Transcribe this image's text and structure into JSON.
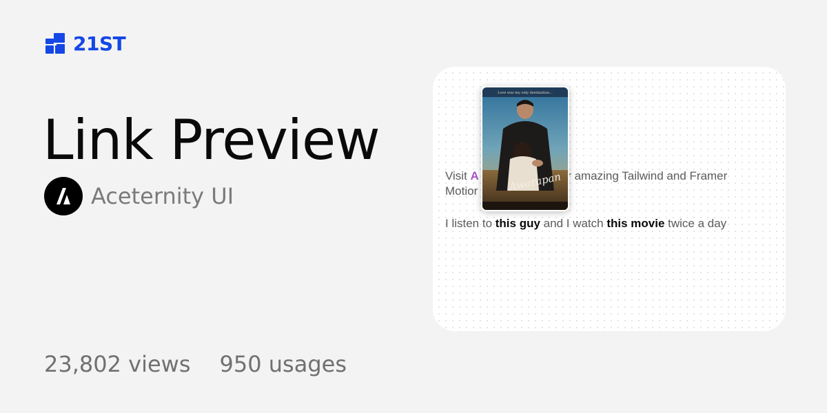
{
  "brand": {
    "name": "21ST",
    "color": "#1447e6"
  },
  "component": {
    "title": "Link Preview",
    "author": "Aceternity UI"
  },
  "stats": {
    "views": "23,802 views",
    "usages": "950 usages"
  },
  "preview": {
    "paragraph1": {
      "prefix": "Visit ",
      "link_visible": "A",
      "suffix": "d for amazing Tailwind and Framer",
      "line2": "Motior"
    },
    "paragraph2": {
      "prefix": "I listen to ",
      "link1": "this guy",
      "middle": " and I watch ",
      "link2": "this movie",
      "suffix": " twice a day"
    },
    "popup": {
      "poster_tagline": "Love was my only destination...",
      "poster_title": "Awarapan"
    },
    "accent_color": "#a855c7"
  }
}
